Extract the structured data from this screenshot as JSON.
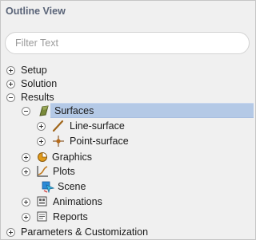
{
  "panel": {
    "title": "Outline View"
  },
  "filter": {
    "placeholder": "Filter Text"
  },
  "tree": {
    "setup": "Setup",
    "solution": "Solution",
    "results": "Results",
    "surfaces": "Surfaces",
    "line_surface": "Line-surface",
    "point_surface": "Point-surface",
    "graphics": "Graphics",
    "plots": "Plots",
    "scene": "Scene",
    "animations": "Animations",
    "reports": "Reports",
    "parameters": "Parameters & Customization"
  },
  "colors": {
    "selection": "#b4c9e6",
    "title": "#5a6478"
  }
}
